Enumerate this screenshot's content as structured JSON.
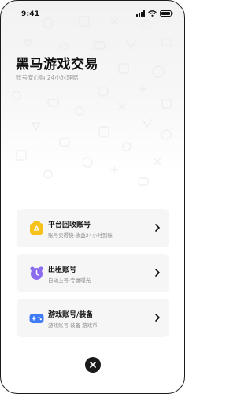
{
  "status_bar": {
    "time": "9:41",
    "icons": [
      "signal-icon",
      "wifi-icon",
      "battery-icon"
    ]
  },
  "header": {
    "title": "黑马游戏交易",
    "subtitle": "账号安心购 24小时理赔"
  },
  "menu": {
    "items": [
      {
        "label": "平台回收账号",
        "description": "账号卖得快·收益24小时到账",
        "icon": "recycle-bag-icon",
        "icon_color": "#F7C21B"
      },
      {
        "label": "出租账号",
        "description": "自动上号·专属曝光",
        "icon": "alarm-clock-icon",
        "icon_color": "#8B6CF0"
      },
      {
        "label": "游戏账号/装备",
        "description": "游戏账号·装备·游戏币",
        "icon": "gamepad-icon",
        "icon_color": "#3F7BF5"
      }
    ]
  },
  "close_button": {
    "icon": "close-icon"
  }
}
